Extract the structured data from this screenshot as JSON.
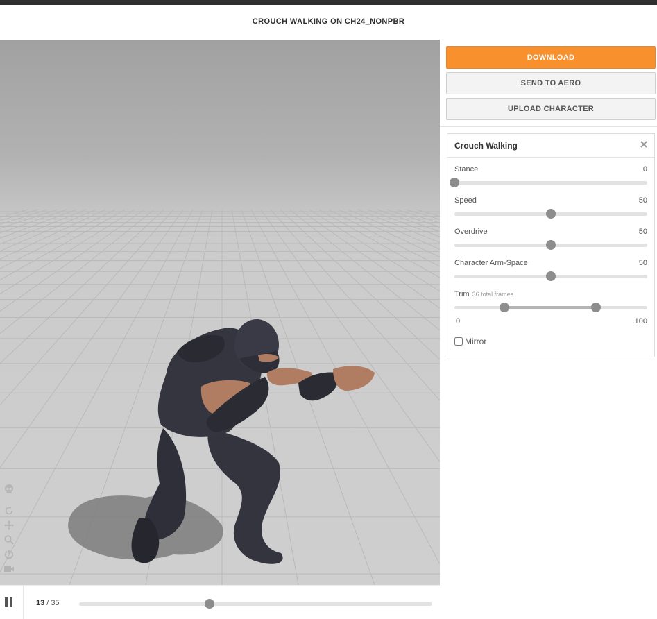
{
  "header": {
    "title": "CROUCH WALKING ON CH24_NONPBR"
  },
  "actions": {
    "download_label": "DOWNLOAD",
    "send_label": "SEND TO AERO",
    "upload_label": "UPLOAD CHARACTER"
  },
  "animation_card": {
    "title": "Crouch Walking",
    "params": [
      {
        "label": "Stance",
        "value": "0",
        "fraction": 0.0
      },
      {
        "label": "Speed",
        "value": "50",
        "fraction": 0.5
      },
      {
        "label": "Overdrive",
        "value": "50",
        "fraction": 0.5
      },
      {
        "label": "Character Arm-Space",
        "value": "50",
        "fraction": 0.5
      }
    ],
    "trim": {
      "label": "Trim",
      "note": "36 total frames",
      "min_label": "0",
      "max_label": "100",
      "start_fraction": 0.26,
      "end_fraction": 0.735
    },
    "mirror_label": "Mirror",
    "mirror_checked": false
  },
  "timeline": {
    "current_frame": "13",
    "separator": " / ",
    "total_frames": "35",
    "progress_fraction": 0.37
  },
  "viewport_tools": [
    "skull-icon",
    "reset-icon",
    "pan-icon",
    "zoom-icon",
    "power-icon",
    "camera-icon"
  ],
  "colors": {
    "accent": "#f7902d",
    "slider_thumb": "#8d8d8d",
    "character_suit": "#34343f",
    "skin": "#b07d62"
  }
}
